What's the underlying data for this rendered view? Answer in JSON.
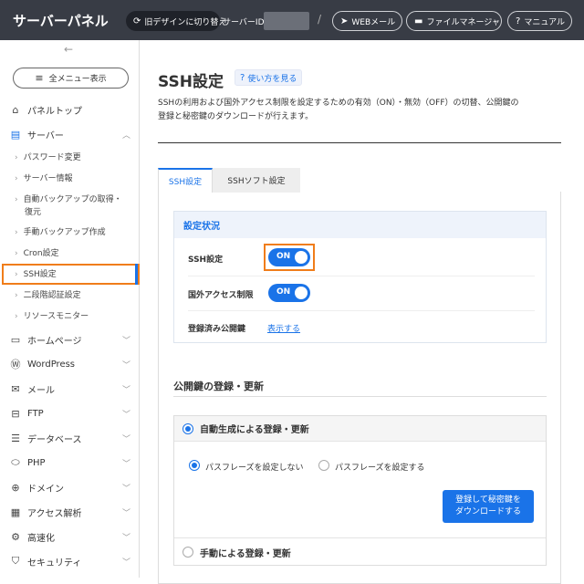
{
  "header": {
    "logo": "サーバーパネル",
    "old_design": "旧デザインに切り替え",
    "server_id_label": "サーバーID",
    "separator": "/",
    "webmail": "WEBメール",
    "file_manager": "ファイルマネージャ",
    "manual": "マニュアル"
  },
  "sidebar": {
    "back_arrow": "←",
    "all_menu": "全メニュー表示",
    "panel_top": "パネルトップ",
    "server": "サーバー",
    "server_sub": [
      "パスワード変更",
      "サーバー情報",
      "自動バックアップの取得・",
      "復元",
      "手動バックアップ作成",
      "Cron設定",
      "SSH設定",
      "二段階認証設定",
      "リソースモニター"
    ],
    "items": [
      {
        "label": "ホームページ",
        "icon": "monitor-icon"
      },
      {
        "label": "WordPress",
        "icon": "wordpress-icon"
      },
      {
        "label": "メール",
        "icon": "mail-icon"
      },
      {
        "label": "FTP",
        "icon": "ftp-icon"
      },
      {
        "label": "データベース",
        "icon": "database-icon"
      },
      {
        "label": "PHP",
        "icon": "php-icon"
      },
      {
        "label": "ドメイン",
        "icon": "globe-icon"
      },
      {
        "label": "アクセス解析",
        "icon": "chart-icon"
      },
      {
        "label": "高速化",
        "icon": "speed-icon"
      },
      {
        "label": "セキュリティ",
        "icon": "shield-icon"
      }
    ]
  },
  "main": {
    "title": "SSH設定",
    "help_link": "使い方を見る",
    "description_line1": "SSHの利用および国外アクセス制限を設定するための有効（ON）・無効（OFF）の切替、公開鍵の",
    "description_line2": "登録と秘密鍵のダウンロードが行えます。",
    "tabs": [
      "SSH設定",
      "SSHソフト設定"
    ],
    "status": {
      "header": "設定状況",
      "ssh_label": "SSH設定",
      "ssh_value": "ON",
      "foreign_label": "国外アクセス制限",
      "foreign_value": "ON",
      "pubkey_label": "登録済み公開鍵",
      "pubkey_link": "表示する"
    },
    "register": {
      "title": "公開鍵の登録・更新",
      "auto_option": "自動生成による登録・更新",
      "no_passphrase": "パスフレーズを設定しない",
      "with_passphrase": "パスフレーズを設定する",
      "download_line1": "登録して秘密鍵を",
      "download_line2": "ダウンロードする",
      "manual_option": "手動による登録・更新"
    }
  }
}
